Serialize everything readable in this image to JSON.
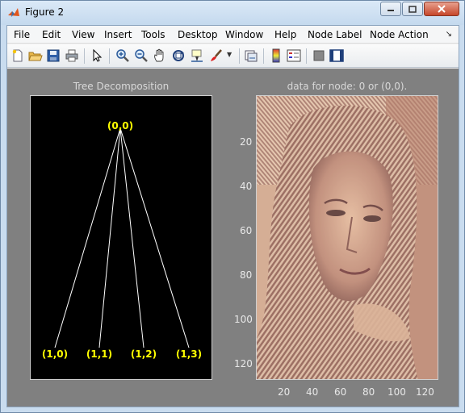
{
  "window": {
    "title": "Figure 2"
  },
  "menu": {
    "items": [
      "File",
      "Edit",
      "View",
      "Insert",
      "Tools",
      "Desktop",
      "Window",
      "Help",
      "Node Label",
      "Node Action"
    ]
  },
  "toolbar": {
    "buttons": [
      "new-figure",
      "open-file",
      "save",
      "print",
      "edit-plot",
      "zoom-in",
      "zoom-out",
      "pan",
      "rotate-3d",
      "data-cursor",
      "brush",
      "link-plot",
      "insert-colorbar",
      "insert-legend",
      "hide-plot-tools",
      "show-plot-tools"
    ]
  },
  "tree_panel": {
    "title": "Tree Decomposition",
    "root_label": "(0,0)",
    "child_labels": [
      "(1,0)",
      "(1,1)",
      "(1,2)",
      "(1,3)"
    ],
    "background_color": "#000000",
    "label_color": "#ffff00",
    "edge_color": "#ffffff"
  },
  "image_panel": {
    "title": "data for node: 0 or (0,0).",
    "y_ticks": [
      "20",
      "40",
      "60",
      "80",
      "100",
      "120"
    ],
    "x_ticks": [
      "20",
      "40",
      "60",
      "80",
      "100",
      "120"
    ]
  }
}
